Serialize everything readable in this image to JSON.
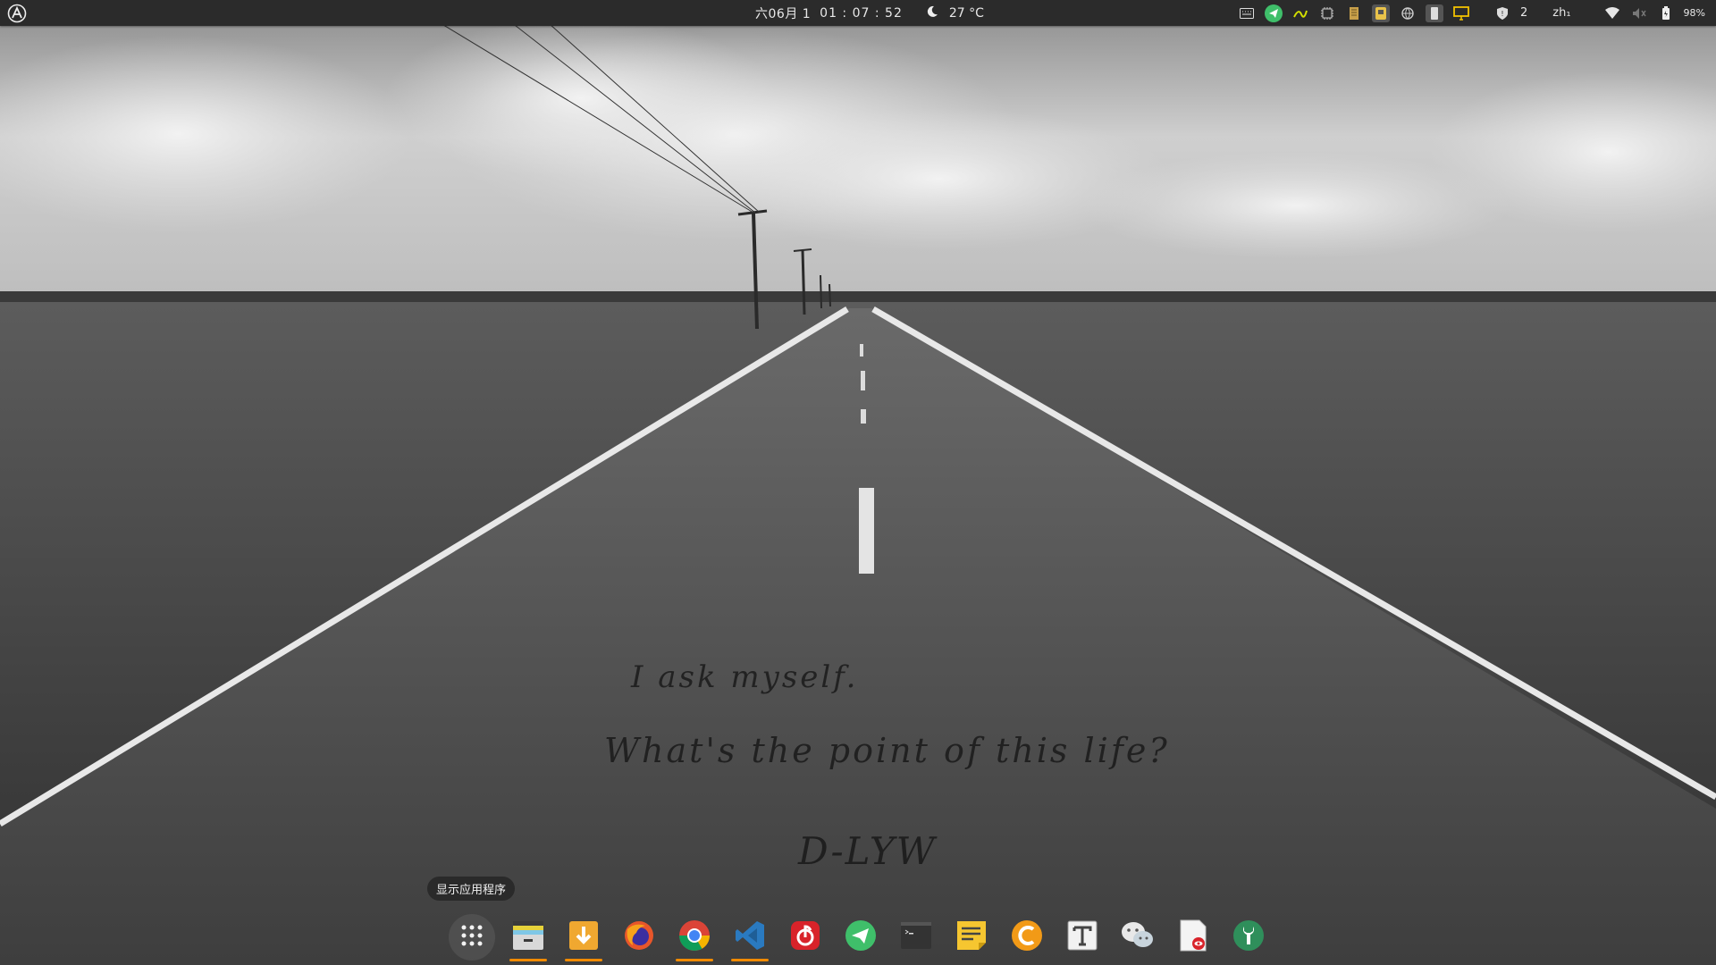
{
  "panel": {
    "date": "六06月 1",
    "time": "01 : 07 : 52",
    "weather_icon": "moon-icon",
    "temperature": "27 °C",
    "tray": {
      "workspace_count": "2",
      "input_method": "zh₁",
      "battery": "98%"
    }
  },
  "desktop": {
    "quote_line_1": "I ask myself.",
    "quote_line_2": "What's the point of this life?",
    "signature": "D-LYW"
  },
  "dock": {
    "tooltip": "显示应用程序",
    "items": [
      {
        "name": "show-applications-button",
        "icon": "grid-icon",
        "running": false
      },
      {
        "name": "files-app",
        "icon": "file-manager-icon",
        "running": true
      },
      {
        "name": "downloader-app",
        "icon": "download-icon",
        "running": true
      },
      {
        "name": "firefox-app",
        "icon": "firefox-icon",
        "running": false
      },
      {
        "name": "chrome-app",
        "icon": "chrome-icon",
        "running": true
      },
      {
        "name": "vscode-app",
        "icon": "vscode-icon",
        "running": true
      },
      {
        "name": "netease-music-app",
        "icon": "music-icon",
        "running": false
      },
      {
        "name": "telegram-app",
        "icon": "telegram-icon",
        "running": false
      },
      {
        "name": "terminal-app",
        "icon": "terminal-icon",
        "running": false
      },
      {
        "name": "notes-app",
        "icon": "sticky-notes-icon",
        "running": false
      },
      {
        "name": "orange-app",
        "icon": "orange-c-icon",
        "running": false
      },
      {
        "name": "typora-app",
        "icon": "typora-icon",
        "running": false
      },
      {
        "name": "wechat-app",
        "icon": "wechat-icon",
        "running": false
      },
      {
        "name": "document-viewer-app",
        "icon": "document-viewer-icon",
        "running": false
      },
      {
        "name": "settings-tweaks-app",
        "icon": "wrench-icon",
        "running": false
      }
    ]
  },
  "colors": {
    "panel_bg": "#2b2b2b",
    "running_indicator": "#f28b00"
  }
}
